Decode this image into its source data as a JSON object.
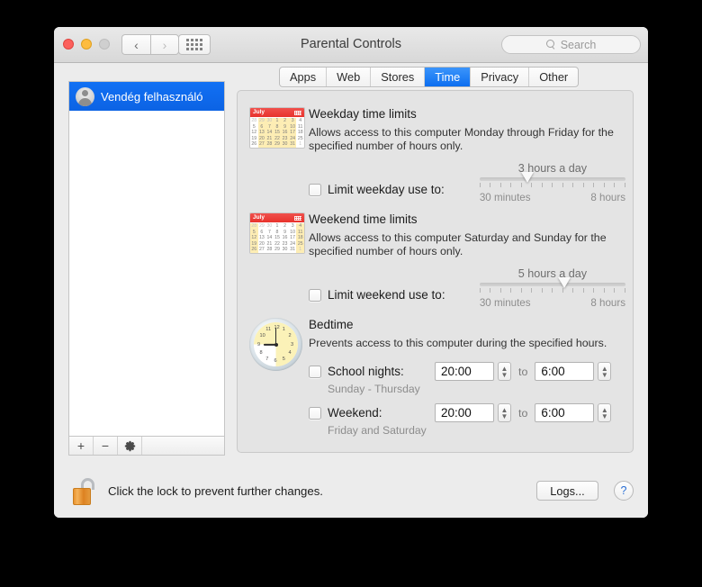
{
  "window": {
    "title": "Parental Controls",
    "traffic_lights": [
      "close",
      "minimize",
      "zoom"
    ],
    "nav_back": "‹",
    "nav_forward": "›",
    "grid_button": "show-all-grid",
    "search": {
      "placeholder": "Search",
      "value": ""
    }
  },
  "tabs": [
    {
      "label": "Apps",
      "active": false
    },
    {
      "label": "Web",
      "active": false
    },
    {
      "label": "Stores",
      "active": false
    },
    {
      "label": "Time",
      "active": true
    },
    {
      "label": "Privacy",
      "active": false
    },
    {
      "label": "Other",
      "active": false
    }
  ],
  "accent_color": "#0c6ef0",
  "sidebar": {
    "users": [
      {
        "name": "Vendég felhasználó",
        "selected": true
      }
    ],
    "toolbar": {
      "add": "+",
      "remove": "−",
      "settings": "gear-icon"
    }
  },
  "sections": {
    "weekday": {
      "icon": "calendar-icon",
      "calendar_month": "July",
      "title": "Weekday time limits",
      "description": "Allows access to this computer Monday through Friday for the specified number of hours only.",
      "checkbox_label": "Limit weekday use to:",
      "checked": false,
      "slider": {
        "value_label": "3 hours a day",
        "min_label": "30 minutes",
        "max_label": "8 hours",
        "percent": 33,
        "ticks": 15
      }
    },
    "weekend": {
      "icon": "calendar-icon",
      "calendar_month": "July",
      "title": "Weekend time limits",
      "description": "Allows access to this computer Saturday and Sunday for the specified number of hours only.",
      "checkbox_label": "Limit weekend use to:",
      "checked": false,
      "slider": {
        "value_label": "5 hours a day",
        "min_label": "30 minutes",
        "max_label": "8 hours",
        "percent": 58,
        "ticks": 15
      }
    },
    "bedtime": {
      "icon": "clock-icon",
      "title": "Bedtime",
      "description": "Prevents access to this computer during the specified hours.",
      "rows": [
        {
          "checkbox_label": "School nights:",
          "checked": false,
          "sublabel": "Sunday - Thursday",
          "from": "20:00",
          "to_label": "to",
          "to": "6:00"
        },
        {
          "checkbox_label": "Weekend:",
          "checked": false,
          "sublabel": "Friday and Saturday",
          "from": "20:00",
          "to_label": "to",
          "to": "6:00"
        }
      ]
    }
  },
  "footer": {
    "lock_icon": "unlocked-padlock-icon",
    "lock_text": "Click the lock to prevent further changes.",
    "logs_button": "Logs...",
    "help_button": "?"
  },
  "calendar_weekday_rows": [
    [
      {
        "t": "28",
        "d": true
      },
      {
        "t": "29",
        "d": true
      },
      {
        "t": "30",
        "d": true
      },
      {
        "t": "1"
      },
      {
        "t": "2"
      },
      {
        "t": "3"
      },
      {
        "t": "4"
      }
    ],
    [
      {
        "t": "5"
      },
      {
        "t": "6"
      },
      {
        "t": "7"
      },
      {
        "t": "8"
      },
      {
        "t": "9"
      },
      {
        "t": "10"
      },
      {
        "t": "11"
      }
    ],
    [
      {
        "t": "12"
      },
      {
        "t": "13"
      },
      {
        "t": "14"
      },
      {
        "t": "15"
      },
      {
        "t": "16"
      },
      {
        "t": "17"
      },
      {
        "t": "18"
      }
    ],
    [
      {
        "t": "19"
      },
      {
        "t": "20"
      },
      {
        "t": "21"
      },
      {
        "t": "22"
      },
      {
        "t": "23"
      },
      {
        "t": "24"
      },
      {
        "t": "25"
      }
    ],
    [
      {
        "t": "26"
      },
      {
        "t": "27"
      },
      {
        "t": "28"
      },
      {
        "t": "29"
      },
      {
        "t": "30"
      },
      {
        "t": "31"
      },
      {
        "t": "1",
        "d": true
      }
    ]
  ],
  "clock": {
    "hours": [
      "12",
      "1",
      "2",
      "3",
      "4",
      "5",
      "6",
      "7",
      "8",
      "9",
      "10",
      "11"
    ],
    "time": "9:00"
  }
}
